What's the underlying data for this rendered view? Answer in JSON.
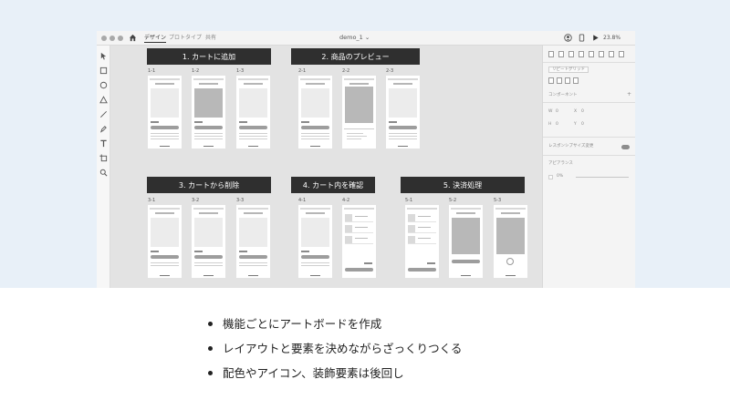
{
  "colors": {
    "page_background_top": "#e8f0f8",
    "window_canvas": "#e3e3e3",
    "section_header_bg": "#2f2f2f",
    "section_header_text": "#ffffff"
  },
  "titlebar": {
    "window_dots": [
      "close",
      "minimize",
      "zoom"
    ],
    "home_icon": "home-icon",
    "tabs": [
      {
        "label": "デザイン",
        "active": true
      },
      {
        "label": "プロトタイプ",
        "active": false
      },
      {
        "label": "共有",
        "active": false
      }
    ],
    "document_title": "demo_1 ⌄",
    "zoom": "23.8%",
    "right_icons": [
      "user-icon",
      "device-preview-icon",
      "play-icon"
    ]
  },
  "tools": [
    "select-tool-icon",
    "rectangle-tool-icon",
    "ellipse-tool-icon",
    "polygon-tool-icon",
    "line-tool-icon",
    "pen-tool-icon",
    "text-tool-icon",
    "artboard-tool-icon",
    "zoom-tool-icon"
  ],
  "sections": [
    {
      "title": "1. カートに追加",
      "labels": [
        "1-1",
        "1-2",
        "1-3"
      ]
    },
    {
      "title": "2. 商品のプレビュー",
      "labels": [
        "2-1",
        "2-2",
        "2-3"
      ]
    },
    {
      "title": "3. カートから削除",
      "labels": [
        "3-1",
        "3-2",
        "3-3"
      ]
    },
    {
      "title": "4. カート内を確認",
      "labels": [
        "4-1",
        "4-2"
      ]
    },
    {
      "title": "5. 決済処理",
      "labels": [
        "5-1",
        "5-2",
        "5-3"
      ]
    }
  ],
  "artboard_product_title": "HANDBALL SPECIAL",
  "inspector": {
    "repeat_grid": "リピートグリッド",
    "component": "コンポーネント",
    "w_label": "W",
    "h_label": "H",
    "x_label": "X",
    "y_label": "Y",
    "w_value": "0",
    "h_value": "0",
    "x_value": "0",
    "y_value": "0",
    "responsive_resize": "レスポンシブサイズ変更",
    "appearance": "アピアランス",
    "opacity_value": "0%"
  },
  "bullets": [
    "機能ごとにアートボードを作成",
    "レイアウトと要素を決めながらざっくりつくる",
    "配色やアイコン、装飾要素は後回し"
  ]
}
